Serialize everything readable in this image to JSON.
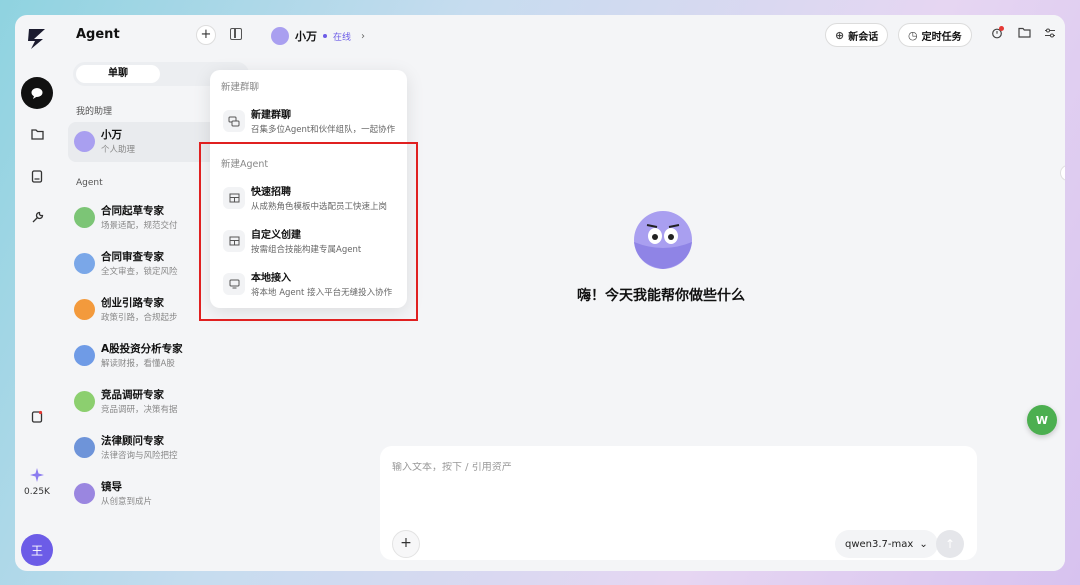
{
  "app": {
    "section_title": "Agent"
  },
  "rail": {
    "usage": "0.25K",
    "user_initial": "王"
  },
  "sidebar": {
    "tab_active": "单聊",
    "my_assistant_label": "我的助理",
    "agent_label": "Agent",
    "assistant": {
      "name": "小万",
      "desc": "个人助理"
    },
    "agents": [
      {
        "name": "合同起草专家",
        "desc": "场景适配，规范交付",
        "color": "#7cc576"
      },
      {
        "name": "合同审查专家",
        "desc": "全文审查，锁定风险",
        "color": "#7aa7e8"
      },
      {
        "name": "创业引路专家",
        "desc": "政策引路，合规起步",
        "color": "#f39a3c"
      },
      {
        "name": "A股投资分析专家",
        "desc": "解读财报，看懂A股",
        "color": "#6f9be6"
      },
      {
        "name": "竞品调研专家",
        "desc": "竞品调研，决策有据",
        "color": "#8ccf6f"
      },
      {
        "name": "法律顾问专家",
        "desc": "法律咨询与风险把控",
        "color": "#6e94d9"
      },
      {
        "name": "镜导",
        "desc": "从创意到成片",
        "color": "#9a86e0"
      }
    ]
  },
  "header": {
    "agent_name": "小万",
    "status": "在线",
    "new_chat": "新会话",
    "scheduled_task": "定时任务"
  },
  "main": {
    "greeting": "嗨！今天我能帮你做些什么"
  },
  "composer": {
    "placeholder": "输入文本，按下 / 引用资产",
    "model": "qwen3.7-max"
  },
  "menu": {
    "group_section": "新建群聊",
    "group_item": {
      "title": "新建群聊",
      "desc": "召集多位Agent和伙伴组队，一起协作"
    },
    "agent_section": "新建Agent",
    "agent_items": [
      {
        "title": "快速招聘",
        "desc": "从成熟角色模板中选配员工快速上岗"
      },
      {
        "title": "自定义创建",
        "desc": "按需组合技能构建专属Agent"
      },
      {
        "title": "本地接入",
        "desc": "将本地 Agent 接入平台无缝投入协作"
      }
    ]
  },
  "float_button": "W",
  "colors": {
    "accent": "#6c5ce7",
    "highlight": "#e02020",
    "float": "#4caf50"
  }
}
